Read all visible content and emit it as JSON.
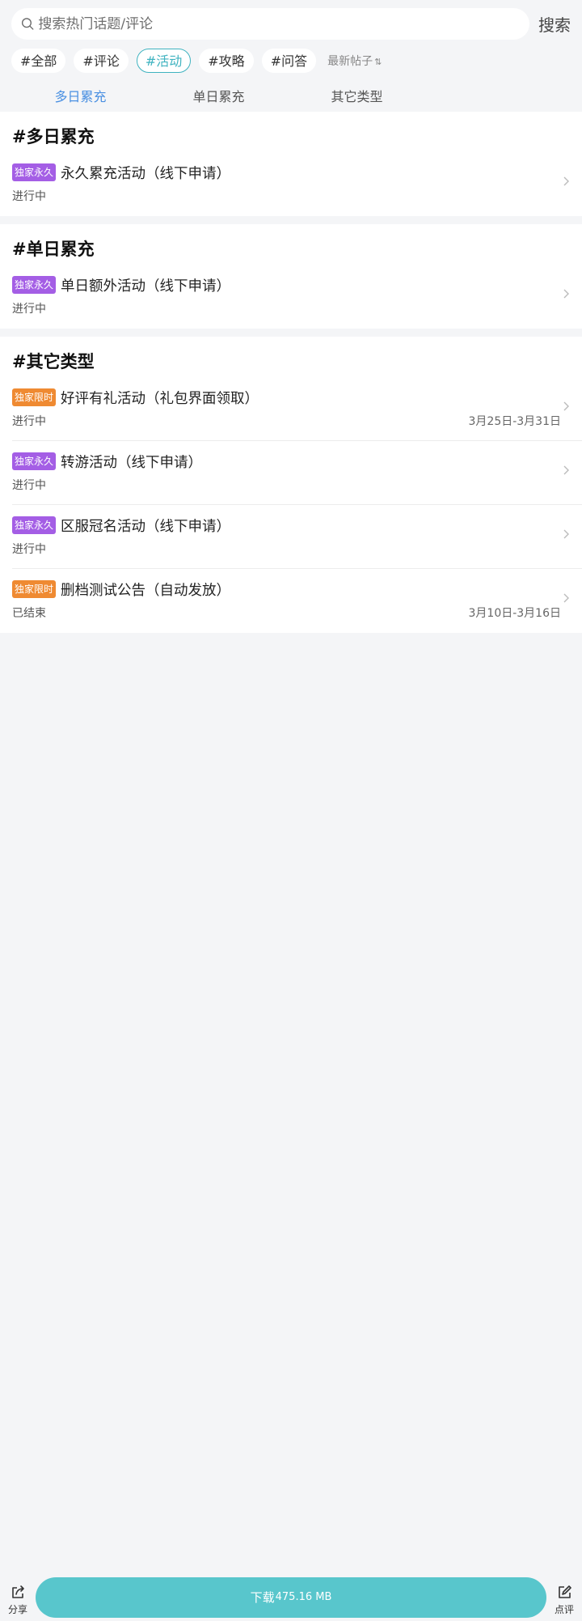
{
  "search": {
    "placeholder": "搜索热门话题/评论",
    "button_label": "搜索"
  },
  "chips": [
    {
      "label": "#全部",
      "active": false
    },
    {
      "label": "#评论",
      "active": false
    },
    {
      "label": "#活动",
      "active": true
    },
    {
      "label": "#攻略",
      "active": false
    },
    {
      "label": "#问答",
      "active": false
    }
  ],
  "sort_label": "最新帖子",
  "sort_icon": "sort-arrows-icon",
  "tabs": [
    {
      "label": "多日累充",
      "active": true
    },
    {
      "label": "单日累充",
      "active": false
    },
    {
      "label": "其它类型",
      "active": false
    }
  ],
  "colors": {
    "badge_permanent": "#a45ee5",
    "badge_limited": "#ef8a32",
    "accent_chip": "#3fb3c0",
    "accent_tab": "#4a90e2",
    "download_button": "#58c6cc"
  },
  "sections": [
    {
      "title": "#多日累充",
      "items": [
        {
          "badge": "独家永久",
          "badge_type": "permanent",
          "title": "永久累充活动（线下申请）",
          "status": "进行中",
          "date": ""
        }
      ]
    },
    {
      "title": "#单日累充",
      "items": [
        {
          "badge": "独家永久",
          "badge_type": "permanent",
          "title": "单日额外活动（线下申请）",
          "status": "进行中",
          "date": ""
        }
      ]
    },
    {
      "title": "#其它类型",
      "items": [
        {
          "badge": "独家限时",
          "badge_type": "limited",
          "title": "好评有礼活动（礼包界面领取）",
          "status": "进行中",
          "date": "3月25日-3月31日"
        },
        {
          "badge": "独家永久",
          "badge_type": "permanent",
          "title": "转游活动（线下申请）",
          "status": "进行中",
          "date": ""
        },
        {
          "badge": "独家永久",
          "badge_type": "permanent",
          "title": "区服冠名活动（线下申请）",
          "status": "进行中",
          "date": ""
        },
        {
          "badge": "独家限时",
          "badge_type": "limited",
          "title": "删档测试公告（自动发放）",
          "status": "已结束",
          "date": "3月10日-3月16日"
        }
      ]
    }
  ],
  "bottom": {
    "share_label": "分享",
    "download_label": "下载",
    "download_size": "475.16 MB",
    "review_label": "点评"
  }
}
